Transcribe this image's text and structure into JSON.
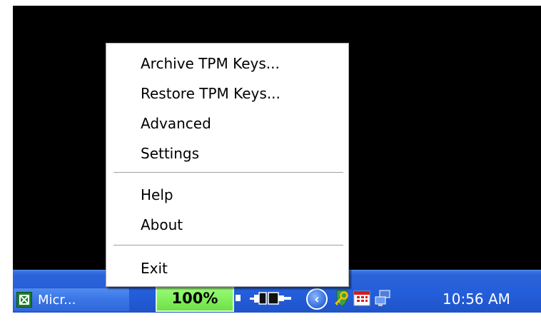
{
  "context_menu": {
    "items": [
      {
        "label": "Archive TPM Keys..."
      },
      {
        "label": "Restore TPM Keys..."
      },
      {
        "label": "Advanced"
      },
      {
        "label": "Settings"
      },
      {
        "label": "Help"
      },
      {
        "label": "About"
      },
      {
        "label": "Exit"
      }
    ]
  },
  "taskbar": {
    "task_button": {
      "label": "Micr...",
      "icon": "excel-icon"
    },
    "tray": {
      "battery_percent": "100%",
      "battery_level": 1.0,
      "icons": [
        "battery-icon",
        "power-plug-icon",
        "show-hidden-icons-chevron",
        "security-key-icon",
        "calendar-app-icon",
        "network-icon"
      ],
      "clock": "10:56 AM"
    }
  },
  "colors": {
    "taskbar_blue": "#245edb",
    "battery_green": "#7ee85a",
    "desktop": "#000000"
  }
}
